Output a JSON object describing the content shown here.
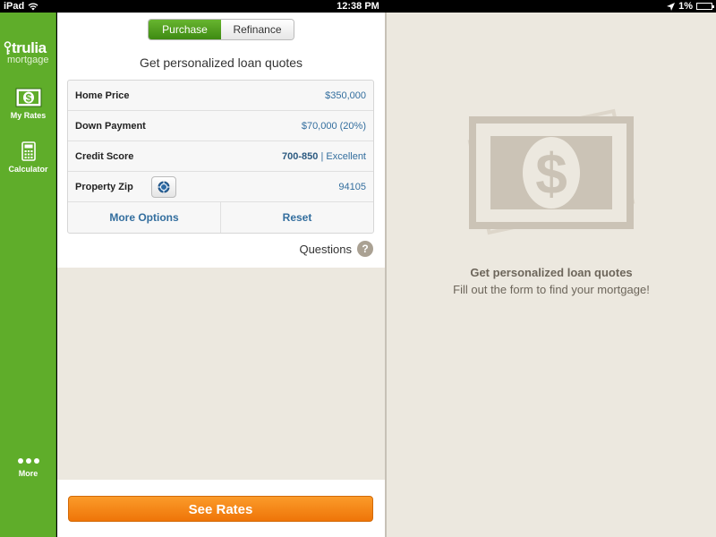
{
  "status_bar": {
    "device": "iPad",
    "time": "12:38 PM",
    "battery": "1%"
  },
  "sidebar": {
    "logo_main": "trulia",
    "logo_sub": "mortgage",
    "items": [
      {
        "label": "My Rates",
        "icon": "money-icon"
      },
      {
        "label": "Calculator",
        "icon": "calculator-icon"
      },
      {
        "label": "More",
        "icon": "more-dots-icon"
      }
    ]
  },
  "tabs": {
    "purchase": "Purchase",
    "refinance": "Refinance",
    "selected": "Purchase"
  },
  "form": {
    "heading": "Get personalized loan quotes",
    "home_price": {
      "label": "Home Price",
      "value": "$350,000"
    },
    "down_payment": {
      "label": "Down Payment",
      "value": "$70,000 (20%)"
    },
    "credit_score": {
      "label": "Credit Score",
      "range": "700-850",
      "separator": "|",
      "rating": "Excellent"
    },
    "property_zip": {
      "label": "Property Zip",
      "value": "94105"
    },
    "more_options": "More Options",
    "reset": "Reset",
    "questions": "Questions",
    "questions_icon": "?",
    "see_rates": "See Rates"
  },
  "right_panel": {
    "title": "Get personalized loan quotes",
    "subtitle": "Fill out the form to find your mortgage!"
  },
  "colors": {
    "sidebar_green": "#5fad2a",
    "link_blue": "#336e9e",
    "orange": "#ef7508",
    "panel_bg": "#ece8df"
  }
}
